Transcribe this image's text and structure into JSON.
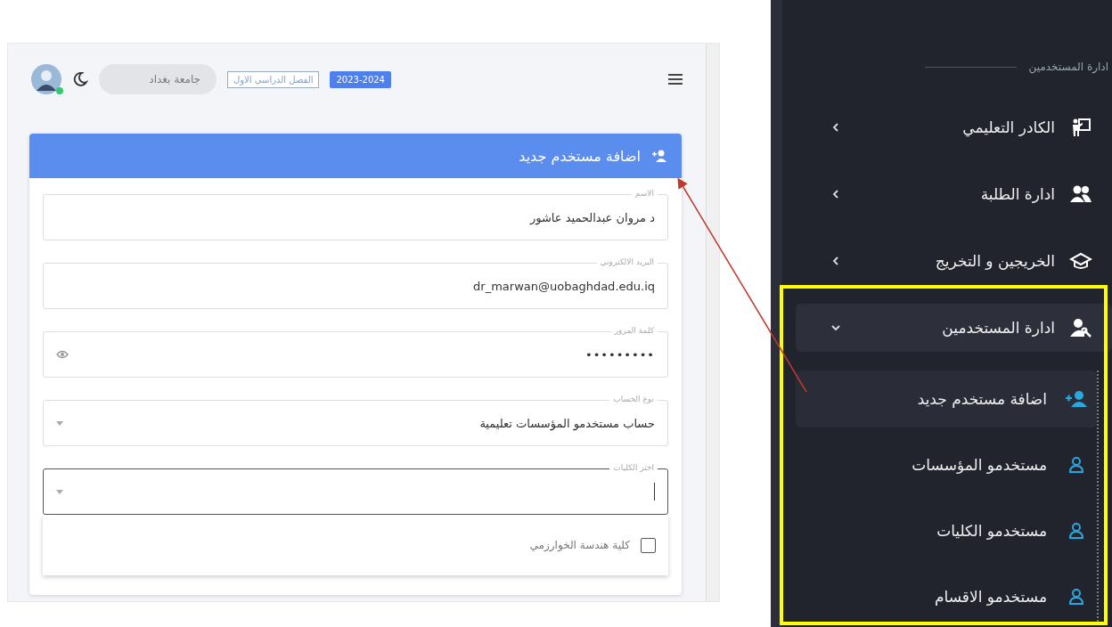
{
  "topbar": {
    "year": "2023-2024",
    "semester": "الفصل الدراسي الاول",
    "university": "جامعة بغداد",
    "dark_mode": false
  },
  "form": {
    "title": "اضافة مستخدم جديد",
    "fields": [
      {
        "kind": "text",
        "label": "الاسم",
        "value": "د مروان عبدالحميد عاشور",
        "focused": false
      },
      {
        "kind": "text",
        "label": "البريد الالكتروني",
        "value": "dr_marwan@uobaghdad.edu.iq",
        "focused": false
      },
      {
        "kind": "password",
        "label": "كلمة المرور",
        "value": "•••••••••",
        "focused": false
      },
      {
        "kind": "select",
        "label": "نوع الحساب",
        "value": "حساب مستخدمو المؤسسات تعليمية",
        "focused": false
      },
      {
        "kind": "select",
        "label": "اختر الكليات",
        "focused": true
      }
    ],
    "options": [
      {
        "label": "كلية هندسة الخوارزمي",
        "checked": false
      }
    ]
  },
  "sidebar": {
    "section": "ادارة المستخدمين",
    "items": [
      {
        "label": "الكادر التعليمي",
        "expanded": false
      },
      {
        "label": "ادارة الطلبة",
        "expanded": false
      },
      {
        "label": "الخريجين و التخريج",
        "expanded": false
      },
      {
        "label": "ادارة المستخدمين",
        "expanded": true,
        "children": [
          {
            "label": "اضافة مستخدم جديد",
            "selected": true
          },
          {
            "label": "مستخدمو المؤسسات",
            "selected": false
          },
          {
            "label": "مستخدمو الكليات",
            "selected": false
          },
          {
            "label": "مستخدمو الاقسام",
            "selected": false
          }
        ]
      }
    ]
  }
}
